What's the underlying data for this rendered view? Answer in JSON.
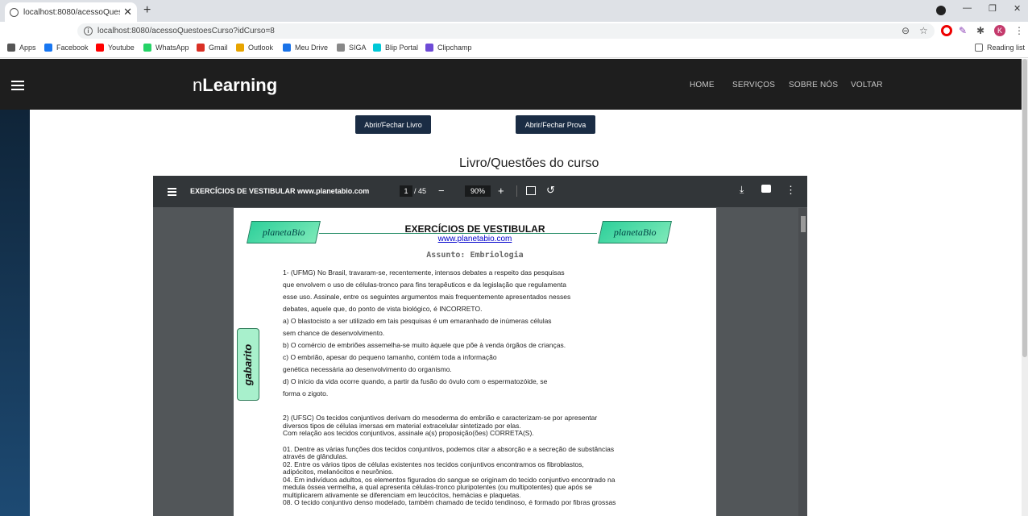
{
  "browser": {
    "tab_title": "localhost:8080/acessoQuestoesC",
    "url": "localhost:8080/acessoQuestoesCurso?idCurso=8",
    "profile_initial": "K",
    "bookmarks": [
      {
        "label": "Apps",
        "icon": "apps-grid-icon",
        "color": "#555555"
      },
      {
        "label": "Facebook",
        "icon": "facebook-icon",
        "color": "#1877f2"
      },
      {
        "label": "Youtube",
        "icon": "youtube-icon",
        "color": "#ff0000"
      },
      {
        "label": "WhatsApp",
        "icon": "whatsapp-icon",
        "color": "#25d366"
      },
      {
        "label": "Gmail",
        "icon": "gmail-icon",
        "color": "#d93025"
      },
      {
        "label": "Outlook",
        "icon": "outlook-icon",
        "color": "#e7a400"
      },
      {
        "label": "Meu Drive",
        "icon": "drive-icon",
        "color": "#1a73e8"
      },
      {
        "label": "SIGA",
        "icon": "siga-icon",
        "color": "#888888"
      },
      {
        "label": "Blip Portal",
        "icon": "blip-icon",
        "color": "#00c8d7"
      },
      {
        "label": "Clipchamp",
        "icon": "clipchamp-icon",
        "color": "#6e4bd6"
      }
    ],
    "reading_list": "Reading list"
  },
  "site": {
    "brand_light": "n",
    "brand_bold": "Learning",
    "nav": [
      "HOME",
      "SERVIÇOS",
      "SOBRE NÓS",
      "VOLTAR"
    ],
    "btn_livro": "Abrir/Fechar Livro",
    "btn_prova": "Abrir/Fechar Prova",
    "section_title": "Livro/Questões do curso"
  },
  "pdf": {
    "title": "EXERCÍCIOS DE VESTIBULAR www.planetabio.com",
    "page": "1",
    "page_total": "/ 45",
    "zoom": "90%",
    "logo_text": "planetaBio",
    "doc_title": "EXERCÍCIOS DE VESTIBULAR",
    "doc_url": "www.planetabio.com",
    "assunto": "Assunto: Embriologia",
    "gabarito": "gabarito",
    "q1_lines": [
      "1- (UFMG) No Brasil, travaram-se, recentemente, intensos debates a respeito das pesquisas",
      "que envolvem o uso de células-tronco para fins terapêuticos e da legislação que regulamenta",
      "esse uso. Assinale, entre os seguintes argumentos mais frequentemente apresentados nesses",
      "debates, aquele que, do ponto de vista biológico, é INCORRETO.",
      "a) O blastocisto a ser utilizado em tais pesquisas é um emaranhado de inúmeras células",
      "sem chance de desenvolvimento.",
      "b) O comércio de embriões assemelha-se muito àquele que põe à venda órgãos de crianças.",
      "c) O embrião, apesar do pequeno tamanho, contém toda a informação",
      "genética necessária ao desenvolvimento do organismo.",
      "d) O início da vida ocorre quando, a partir da fusão do óvulo com o espermatozóide, se",
      "forma o zigoto."
    ],
    "q2_lines": [
      "2) (UFSC) Os tecidos conjuntivos derivam do mesoderma do embrião e caracterizam-se por apresentar",
      "diversos tipos de células imersas em material extracelular sintetizado por elas.",
      "Com relação aos tecidos conjuntivos, assinale a(s) proposição(ões) CORRETA(S).",
      "",
      "01. Dentre as várias funções dos tecidos conjuntivos, podemos citar a absorção e a secreção de substâncias",
      "através de glândulas.",
      "02. Entre os vários tipos de células existentes nos tecidos conjuntivos encontramos os fibroblastos,",
      "adipócitos, melanócitos e neurônios.",
      "04. Em indivíduos adultos, os elementos figurados do sangue se originam do tecido conjuntivo encontrado na",
      "medula óssea vermelha, a qual apresenta células-tronco pluripotentes (ou multipotentes) que após se",
      "multiplicarem ativamente se diferenciam em leucócitos, hemácias e plaquetas.",
      "08. O tecido conjuntivo denso modelado, também chamado de tecido tendinoso, é formado por fibras grossas"
    ]
  }
}
